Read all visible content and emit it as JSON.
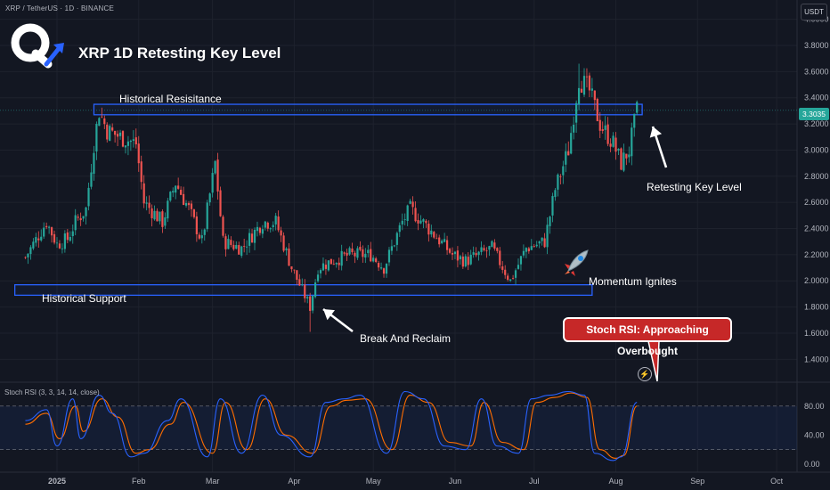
{
  "header": {
    "symbol_line": "XRP / TetherUS · 1D · BINANCE",
    "title": "XRP 1D Retesting Key Level",
    "currency": "USDT",
    "last_price": "3.3035"
  },
  "logo": {
    "icon": "q-logo-with-arrow-icon",
    "accent": "#2962ff"
  },
  "indicator": {
    "label": "Stoch RSI (3, 3, 14, 14, close)",
    "k_color": "#2962ff",
    "d_color": "#ff6d00"
  },
  "annotations": {
    "resistance": "Historical Resisitance",
    "support": "Historical Support",
    "break_reclaim": "Break And Reclaim",
    "momentum": "Momentum Ignites",
    "retest": "Retesting Key Level",
    "stoch_badge": "Stoch RSI: Approaching Overbought"
  },
  "colors": {
    "up": "#26a69a",
    "down": "#ef5350",
    "zone": "#2962ff",
    "background": "#131722",
    "badge": "#c62828"
  },
  "chart_data": [
    {
      "type": "candlestick",
      "title": "XRP 1D Retesting Key Level",
      "x_tick_labels": [
        "2025",
        "Feb",
        "Mar",
        "Apr",
        "May",
        "Jun",
        "Jul",
        "Aug",
        "Sep",
        "Oct"
      ],
      "y_tick_labels": [
        "1.4000",
        "1.6000",
        "1.8000",
        "2.0000",
        "2.2000",
        "2.4000",
        "2.6000",
        "2.8000",
        "3.0000",
        "3.2000",
        "3.4000",
        "3.6000",
        "3.8000",
        "4.0000"
      ],
      "ylim": [
        1.3,
        4.1
      ],
      "close_path": [
        [
          "2024-12-20",
          2.18
        ],
        [
          "2024-12-28",
          2.45
        ],
        [
          "2025-01-01",
          2.28
        ],
        [
          "2025-01-05",
          2.32
        ],
        [
          "2025-01-08",
          2.45
        ],
        [
          "2025-01-12",
          2.55
        ],
        [
          "2025-01-15",
          3.05
        ],
        [
          "2025-01-17",
          3.3
        ],
        [
          "2025-01-20",
          3.15
        ],
        [
          "2025-01-25",
          3.1
        ],
        [
          "2025-01-31",
          3.05
        ],
        [
          "2025-02-03",
          2.6
        ],
        [
          "2025-02-10",
          2.45
        ],
        [
          "2025-02-15",
          2.75
        ],
        [
          "2025-02-20",
          2.55
        ],
        [
          "2025-02-25",
          2.3
        ],
        [
          "2025-03-02",
          2.9
        ],
        [
          "2025-03-05",
          2.3
        ],
        [
          "2025-03-12",
          2.25
        ],
        [
          "2025-03-20",
          2.45
        ],
        [
          "2025-03-25",
          2.45
        ],
        [
          "2025-03-31",
          2.1
        ],
        [
          "2025-04-07",
          1.8
        ],
        [
          "2025-04-10",
          2.1
        ],
        [
          "2025-04-15",
          2.15
        ],
        [
          "2025-04-22",
          2.2
        ],
        [
          "2025-04-30",
          2.2
        ],
        [
          "2025-05-05",
          2.1
        ],
        [
          "2025-05-12",
          2.45
        ],
        [
          "2025-05-15",
          2.55
        ],
        [
          "2025-05-22",
          2.4
        ],
        [
          "2025-05-31",
          2.2
        ],
        [
          "2025-06-05",
          2.15
        ],
        [
          "2025-06-15",
          2.25
        ],
        [
          "2025-06-22",
          2.0
        ],
        [
          "2025-06-28",
          2.25
        ],
        [
          "2025-07-05",
          2.3
        ],
        [
          "2025-07-09",
          2.7
        ],
        [
          "2025-07-14",
          3.0
        ],
        [
          "2025-07-18",
          3.55
        ],
        [
          "2025-07-22",
          3.45
        ],
        [
          "2025-07-26",
          3.2
        ],
        [
          "2025-07-31",
          3.05
        ],
        [
          "2025-08-03",
          2.9
        ],
        [
          "2025-08-06",
          3.0
        ],
        [
          "2025-08-09",
          3.3
        ]
      ],
      "highs_lows": {
        "high": {
          "date": "2025-07-18",
          "value": 3.66
        },
        "low": {
          "date": "2025-04-07",
          "value": 1.61
        }
      }
    },
    {
      "type": "line",
      "title": "Stoch RSI (3, 3, 14, 14, close)",
      "y_tick_labels": [
        "0.00",
        "40.00",
        "80.00"
      ],
      "ylim": [
        0,
        100
      ],
      "bands": [
        20,
        80
      ],
      "series": [
        {
          "name": "%K",
          "color": "#2962ff",
          "points": [
            [
              "2024-12-20",
              60
            ],
            [
              "2024-12-28",
              75
            ],
            [
              "2025-01-01",
              25
            ],
            [
              "2025-01-07",
              90
            ],
            [
              "2025-01-10",
              35
            ],
            [
              "2025-01-17",
              95
            ],
            [
              "2025-01-22",
              70
            ],
            [
              "2025-01-29",
              10
            ],
            [
              "2025-02-03",
              15
            ],
            [
              "2025-02-12",
              60
            ],
            [
              "2025-02-17",
              90
            ],
            [
              "2025-02-27",
              10
            ],
            [
              "2025-03-04",
              90
            ],
            [
              "2025-03-12",
              15
            ],
            [
              "2025-03-20",
              95
            ],
            [
              "2025-03-27",
              40
            ],
            [
              "2025-04-07",
              10
            ],
            [
              "2025-04-13",
              85
            ],
            [
              "2025-04-20",
              90
            ],
            [
              "2025-04-26",
              95
            ],
            [
              "2025-05-06",
              15
            ],
            [
              "2025-05-13",
              100
            ],
            [
              "2025-05-20",
              90
            ],
            [
              "2025-05-28",
              25
            ],
            [
              "2025-06-05",
              20
            ],
            [
              "2025-06-11",
              90
            ],
            [
              "2025-06-17",
              25
            ],
            [
              "2025-06-25",
              15
            ],
            [
              "2025-06-30",
              90
            ],
            [
              "2025-07-07",
              95
            ],
            [
              "2025-07-14",
              100
            ],
            [
              "2025-07-20",
              95
            ],
            [
              "2025-07-24",
              15
            ],
            [
              "2025-07-31",
              5
            ],
            [
              "2025-08-03",
              10
            ],
            [
              "2025-08-09",
              85
            ]
          ]
        },
        {
          "name": "%D",
          "color": "#ff6d00",
          "points": [
            [
              "2024-12-20",
              55
            ],
            [
              "2024-12-28",
              70
            ],
            [
              "2025-01-02",
              35
            ],
            [
              "2025-01-08",
              80
            ],
            [
              "2025-01-11",
              45
            ],
            [
              "2025-01-18",
              90
            ],
            [
              "2025-01-24",
              65
            ],
            [
              "2025-01-31",
              15
            ],
            [
              "2025-02-05",
              20
            ],
            [
              "2025-02-13",
              55
            ],
            [
              "2025-02-18",
              85
            ],
            [
              "2025-03-01",
              15
            ],
            [
              "2025-03-06",
              85
            ],
            [
              "2025-03-14",
              20
            ],
            [
              "2025-03-21",
              90
            ],
            [
              "2025-03-29",
              40
            ],
            [
              "2025-04-08",
              15
            ],
            [
              "2025-04-15",
              80
            ],
            [
              "2025-04-21",
              88
            ],
            [
              "2025-04-28",
              90
            ],
            [
              "2025-05-08",
              20
            ],
            [
              "2025-05-15",
              95
            ],
            [
              "2025-05-22",
              85
            ],
            [
              "2025-05-30",
              30
            ],
            [
              "2025-06-07",
              25
            ],
            [
              "2025-06-12",
              85
            ],
            [
              "2025-06-19",
              30
            ],
            [
              "2025-06-27",
              20
            ],
            [
              "2025-07-02",
              85
            ],
            [
              "2025-07-09",
              92
            ],
            [
              "2025-07-15",
              98
            ],
            [
              "2025-07-21",
              92
            ],
            [
              "2025-07-26",
              20
            ],
            [
              "2025-08-01",
              8
            ],
            [
              "2025-08-04",
              12
            ],
            [
              "2025-08-09",
              80
            ]
          ]
        }
      ]
    }
  ],
  "zones": [
    {
      "name": "Historical Resisitance",
      "from": "2025-01-15",
      "to": "2025-08-11",
      "low": 3.27,
      "high": 3.35
    },
    {
      "name": "Historical Support",
      "from": "2024-12-16",
      "to": "2025-07-23",
      "low": 1.89,
      "high": 1.97
    }
  ]
}
